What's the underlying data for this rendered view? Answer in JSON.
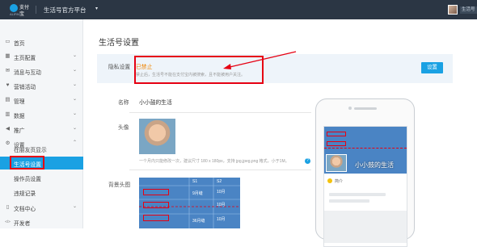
{
  "topbar": {
    "logo_text": "支付宝",
    "logo_sub": "ALIPAY",
    "platform_title": "生活号官方平台",
    "caret": "▾",
    "user_name": "生活号"
  },
  "sidebar": {
    "items": [
      {
        "icon": "▭",
        "label": "首页",
        "caret": ""
      },
      {
        "icon": "▦",
        "label": "主页配置",
        "caret": "⌄"
      },
      {
        "icon": "✉",
        "label": "消息与互动",
        "caret": "⌄"
      },
      {
        "icon": "♥",
        "label": "营销活动",
        "caret": "⌄"
      },
      {
        "icon": "▤",
        "label": "管理",
        "caret": "⌄"
      },
      {
        "icon": "▥",
        "label": "数据",
        "caret": "⌄"
      },
      {
        "icon": "◀",
        "label": "推广",
        "caret": "⌄"
      },
      {
        "icon": "⚙",
        "label": "设置",
        "caret": "⌃"
      }
    ],
    "settings_sub": [
      {
        "label": "在朋友页显示"
      },
      {
        "label": "生活号设置"
      },
      {
        "label": "操作员设置"
      },
      {
        "label": "违规记录"
      }
    ],
    "bottom_items": [
      {
        "icon": "▯",
        "label": "文档中心",
        "caret": "⌄"
      },
      {
        "icon": "</>",
        "label": "开发者",
        "caret": ""
      }
    ]
  },
  "main": {
    "page_title": "生活号设置",
    "privacy": {
      "label": "隐私设置",
      "status": "已禁止",
      "description": "禁止后，生活号不能在支付宝内被搜索，且不能被用户关注。",
      "button": "设置"
    },
    "name_row": {
      "label": "名称",
      "value": "小小鼓的生活"
    },
    "avatar_row": {
      "label": "头像",
      "note": "一个月内只能修改一次，建议尺寸 180 x 180px，支持 jpg,jpeg,png 格式，小于1M。",
      "help": "?"
    },
    "bg_row": {
      "label": "背景头图",
      "headers": [
        "S1",
        "S2"
      ],
      "cells": [
        "9月缝",
        "10月",
        "36月缝",
        "10月",
        "10月"
      ]
    }
  },
  "phone": {
    "name": "小小鼓的生活",
    "intro": "简介"
  },
  "colors": {
    "accent": "#1aa1e3",
    "highlight": "#e60012",
    "status": "#f08300",
    "topbar": "#2b3644"
  }
}
